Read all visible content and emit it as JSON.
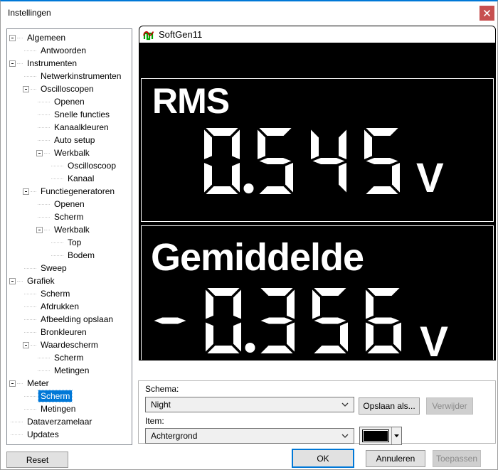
{
  "window": {
    "title": "Instellingen"
  },
  "tree": {
    "items": [
      {
        "label": "Algemeen",
        "level": 0,
        "expander": true
      },
      {
        "label": "Antwoorden",
        "level": 1
      },
      {
        "label": "Instrumenten",
        "level": 0,
        "expander": true
      },
      {
        "label": "Netwerkinstrumenten",
        "level": 1
      },
      {
        "label": "Oscilloscopen",
        "level": 1,
        "expander": true
      },
      {
        "label": "Openen",
        "level": 2
      },
      {
        "label": "Snelle functies",
        "level": 2
      },
      {
        "label": "Kanaalkleuren",
        "level": 2
      },
      {
        "label": "Auto setup",
        "level": 2
      },
      {
        "label": "Werkbalk",
        "level": 2,
        "expander": true
      },
      {
        "label": "Oscilloscoop",
        "level": 3
      },
      {
        "label": "Kanaal",
        "level": 3
      },
      {
        "label": "Functiegeneratoren",
        "level": 1,
        "expander": true
      },
      {
        "label": "Openen",
        "level": 2
      },
      {
        "label": "Scherm",
        "level": 2
      },
      {
        "label": "Werkbalk",
        "level": 2,
        "expander": true
      },
      {
        "label": "Top",
        "level": 3
      },
      {
        "label": "Bodem",
        "level": 3
      },
      {
        "label": "Sweep",
        "level": 1
      },
      {
        "label": "Grafiek",
        "level": 0,
        "expander": true
      },
      {
        "label": "Scherm",
        "level": 1
      },
      {
        "label": "Afdrukken",
        "level": 1
      },
      {
        "label": "Afbeelding opslaan",
        "level": 1
      },
      {
        "label": "Bronkleuren",
        "level": 1
      },
      {
        "label": "Waardescherm",
        "level": 1,
        "expander": true
      },
      {
        "label": "Scherm",
        "level": 2
      },
      {
        "label": "Metingen",
        "level": 2
      },
      {
        "label": "Meter",
        "level": 0,
        "expander": true
      },
      {
        "label": "Scherm",
        "level": 1,
        "selected": true
      },
      {
        "label": "Metingen",
        "level": 1
      },
      {
        "label": "Dataverzamelaar",
        "level": 0
      },
      {
        "label": "Updates",
        "level": 0
      }
    ]
  },
  "preview": {
    "app_title": "SoftGen11",
    "display": {
      "background": "#000000",
      "foreground": "#ffffff"
    },
    "meters": [
      {
        "label": "RMS",
        "value": "0.545",
        "unit": "V"
      },
      {
        "label": "Gemiddelde",
        "value": "-0.356",
        "unit": "V"
      }
    ]
  },
  "scheme": {
    "schema_label": "Schema:",
    "schema_value": "Night",
    "item_label": "Item:",
    "item_value": "Achtergrond",
    "swatch_color": "#000000"
  },
  "buttons": {
    "reset": "Reset",
    "save_as": "Opslaan als...",
    "delete": "Verwijder",
    "ok": "OK",
    "cancel": "Annuleren",
    "apply": "Toepassen"
  },
  "colors": {
    "accent": "#0078d7",
    "close_red": "#c75050",
    "selection": "#0078d7"
  }
}
